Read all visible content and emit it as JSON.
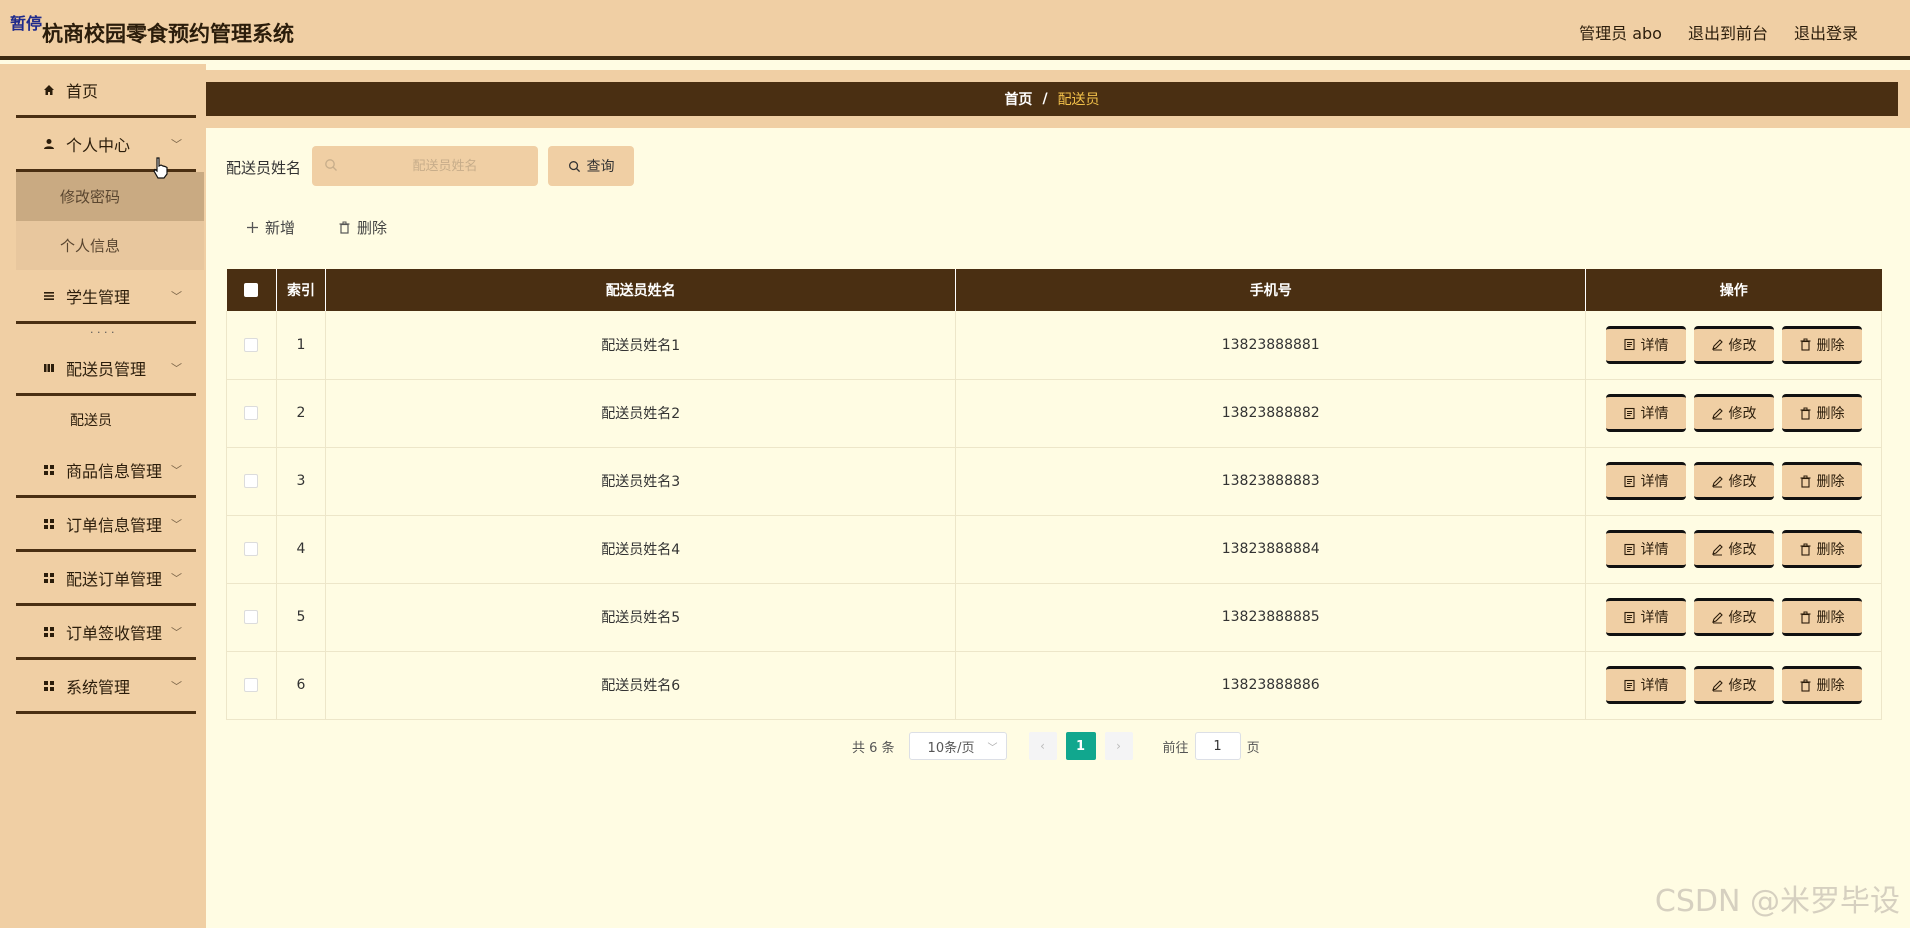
{
  "header": {
    "tag": "暂停",
    "title": "杭商校园零食预约管理系统",
    "admin": "管理员 abo",
    "front": "退出到前台",
    "logout": "退出登录"
  },
  "sidebar": {
    "home": "首页",
    "personal": "个人中心",
    "change_password": "修改密码",
    "personal_info": "个人信息",
    "students": "学生管理",
    "dots": "· · · ·",
    "couriers": "配送员管理",
    "courier": "配送员",
    "goods": "商品信息管理",
    "orders": "订单信息管理",
    "delivery_orders": "配送订单管理",
    "sign_orders": "订单签收管理",
    "system": "系统管理"
  },
  "breadcrumb": {
    "home": "首页",
    "sep": "/",
    "current": "配送员"
  },
  "search": {
    "label": "配送员姓名",
    "placeholder": "配送员姓名",
    "button": "查询"
  },
  "actions": {
    "add": "新增",
    "delete": "删除"
  },
  "table": {
    "headers": [
      "索引",
      "配送员姓名",
      "手机号",
      "操作"
    ],
    "rows": [
      {
        "index": "1",
        "name": "配送员姓名1",
        "phone": "13823888881"
      },
      {
        "index": "2",
        "name": "配送员姓名2",
        "phone": "13823888882"
      },
      {
        "index": "3",
        "name": "配送员姓名3",
        "phone": "13823888883"
      },
      {
        "index": "4",
        "name": "配送员姓名4",
        "phone": "13823888884"
      },
      {
        "index": "5",
        "name": "配送员姓名5",
        "phone": "13823888885"
      },
      {
        "index": "6",
        "name": "配送员姓名6",
        "phone": "13823888886"
      }
    ],
    "ops": {
      "detail": "详情",
      "edit": "修改",
      "delete": "删除"
    }
  },
  "pagination": {
    "total": "共 6 条",
    "page_size": "10条/页",
    "current": "1",
    "goto_label": "前往",
    "goto_value": "1",
    "page_unit": "页"
  },
  "watermark": "CSDN @米罗毕设",
  "colors": {
    "accent": "#4a2f12",
    "panel": "#f0cfa4",
    "background": "#fffce3",
    "page_active": "#11a78e"
  }
}
